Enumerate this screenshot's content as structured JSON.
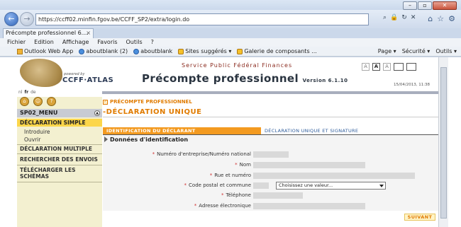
{
  "browser": {
    "url_domain": "https://ccff02.minfin.fgov.be",
    "url_path": "/CCFF_SP2/extra/login.do",
    "tab_title": "Précompte professionnel 6....",
    "menu": [
      "Fichier",
      "Edition",
      "Affichage",
      "Favoris",
      "Outils",
      "?"
    ],
    "favorites": [
      "Outlook Web App",
      "aboutblank (2)",
      "aboutblank",
      "Sites suggérés ▾",
      "Galerie de composants ..."
    ],
    "tools": [
      "Page ▾",
      "Sécurité ▾",
      "Outils ▾"
    ]
  },
  "header": {
    "powered_by": "powered by",
    "logo_text": "CCFF·ATLAS",
    "service": "Service Public Fédéral Finances",
    "title": "Précompte professionnel",
    "version": "Version 6.1.10",
    "date": "15/04/2013, 11:38",
    "font_buttons": [
      "A",
      "A",
      "A"
    ],
    "languages": [
      "nl",
      "fr",
      "de"
    ]
  },
  "sidebar": {
    "menu_title": "SP02_MENU",
    "items": [
      {
        "label": "DÉCLARATION SIMPLE",
        "active": true
      },
      {
        "label": "Introduire"
      },
      {
        "label": "Ouvrir"
      },
      {
        "label": "DÉCLARATION MULTIPLE"
      },
      {
        "label": "RECHERCHER DES ENVOIS"
      },
      {
        "label": "TÉLÉCHARGER LES"
      },
      {
        "label": "SCHÉMAS"
      }
    ]
  },
  "main": {
    "breadcrumb": "PRÉCOMPTE PROFESSIONNEL",
    "section_title": "-DÉCLARATION UNIQUE",
    "tabs": [
      "IDENTIFICATION DU DÉCLARANT",
      "DÉCLARATION UNIQUE ET SIGNATURE"
    ],
    "form_title": "Données d'identification",
    "fields": [
      {
        "label": "Numéro d'entreprise/Numéro national",
        "required": true
      },
      {
        "label": "Nom",
        "required": true
      },
      {
        "label": "Rue et numéro",
        "required": true
      },
      {
        "label": "Code postal et commune",
        "required": true,
        "select_value": "Choisissez une valeur..."
      },
      {
        "label": "Téléphone",
        "required": true
      },
      {
        "label": "Adresse électronique",
        "required": true
      }
    ],
    "next_button": "SUIVANT"
  },
  "colors": {
    "accent_orange": "#f39a20",
    "sidebar_bg": "#f3f0d0",
    "active_item": "#fcd64a"
  }
}
